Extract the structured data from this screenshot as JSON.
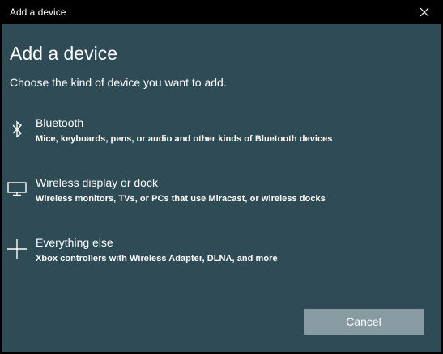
{
  "window": {
    "title": "Add a device"
  },
  "dialog": {
    "heading": "Add a device",
    "subheading": "Choose the kind of device you want to add.",
    "options": [
      {
        "icon": "bluetooth-icon",
        "title": "Bluetooth",
        "description": "Mice, keyboards, pens, or audio and other kinds of Bluetooth devices"
      },
      {
        "icon": "monitor-icon",
        "title": "Wireless display or dock",
        "description": "Wireless monitors, TVs, or PCs that use Miracast, or wireless docks"
      },
      {
        "icon": "plus-icon",
        "title": "Everything else",
        "description": "Xbox controllers with Wireless Adapter, DLNA, and more"
      }
    ],
    "cancel_label": "Cancel"
  },
  "colors": {
    "titlebar": "#000000",
    "background": "#2f4b56",
    "button": "#889ba2",
    "text": "#ffffff"
  }
}
